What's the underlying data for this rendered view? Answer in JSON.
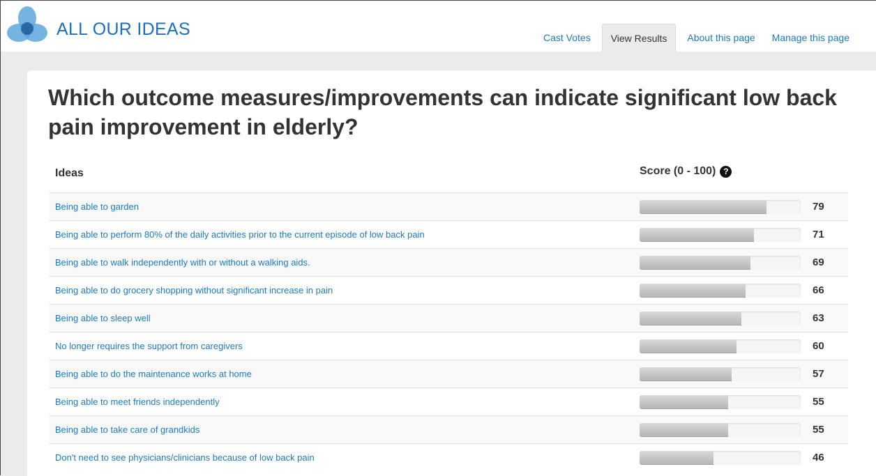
{
  "brand": "ALL OUR IDEAS",
  "tabs": [
    {
      "label": "Cast Votes",
      "active": false
    },
    {
      "label": "View Results",
      "active": true
    },
    {
      "label": "About this page",
      "active": false
    },
    {
      "label": "Manage this page",
      "active": false
    }
  ],
  "question": "Which outcome measures/improvements can indicate significant low back pain improvement in elderly?",
  "table": {
    "ideas_header": "Ideas",
    "score_header": "Score (0 - 100)",
    "help_icon": "question-circle-icon",
    "rows": [
      {
        "idea": "Being able to garden",
        "score": 79
      },
      {
        "idea": "Being able to perform 80% of the daily activities prior to the current episode of low back pain",
        "score": 71
      },
      {
        "idea": "Being able to walk independently with or without a walking aids.",
        "score": 69
      },
      {
        "idea": "Being able to do grocery shopping without significant increase in pain",
        "score": 66
      },
      {
        "idea": "Being able to sleep well",
        "score": 63
      },
      {
        "idea": "No longer requires the support from caregivers",
        "score": 60
      },
      {
        "idea": "Being able to do the maintenance works at home",
        "score": 57
      },
      {
        "idea": "Being able to meet friends independently",
        "score": 55
      },
      {
        "idea": "Being able to take care of grandkids",
        "score": 55
      },
      {
        "idea": "Don't need to see physicians/clinicians because of low back pain",
        "score": 46
      }
    ]
  },
  "colors": {
    "link": "#1b7ac2",
    "brand": "#1f6fb8",
    "background": "#ebebeb"
  }
}
